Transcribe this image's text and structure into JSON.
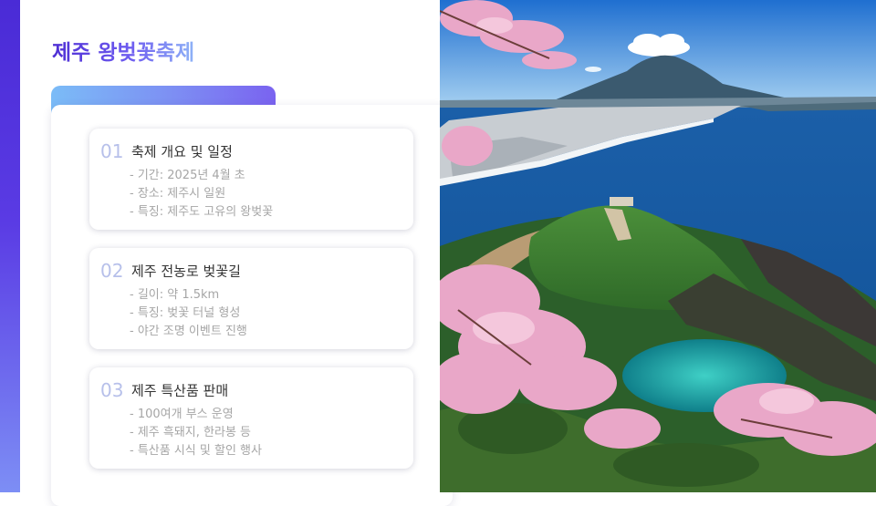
{
  "title": "제주 왕벚꽃축제",
  "sections": [
    {
      "number": "01",
      "title": "축제 개요 및 일정",
      "items": [
        "- 기간: 2025년 4월 초",
        "- 장소: 제주시 일원",
        "- 특징: 제주도 고유의 왕벚꽃"
      ]
    },
    {
      "number": "02",
      "title": "제주 전농로 벚꽃길",
      "items": [
        "- 길이: 약 1.5km",
        "- 특징: 벚꽃 터널 형성",
        "- 야간 조명 이벤트 진행"
      ]
    },
    {
      "number": "03",
      "title": "제주 특산품 판매",
      "items": [
        "- 100여개 부스 운영",
        "- 제주 흑돼지, 한라봉 등",
        "- 특산품 시식 및 할인 행사"
      ]
    }
  ],
  "colors": {
    "accent_purple": "#4f2fd4",
    "accent_blue": "#7bbcf7",
    "number_color": "#b7c0ea"
  },
  "image": {
    "name": "jeju-cherry-blossom-landscape-photo"
  }
}
